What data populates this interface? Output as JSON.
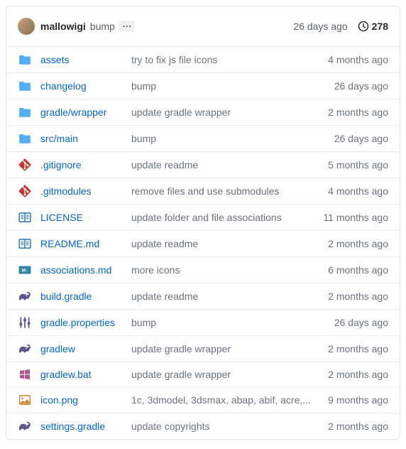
{
  "header": {
    "author": "mallowigi",
    "commit_message": "bump",
    "time": "26 days ago",
    "history_count": "278"
  },
  "files": [
    {
      "icon": "folder",
      "name": "assets",
      "msg": "try to fix js file icons",
      "time": "4 months ago"
    },
    {
      "icon": "folder",
      "name": "changelog",
      "msg": "bump",
      "time": "26 days ago"
    },
    {
      "icon": "folder",
      "name": "gradle/wrapper",
      "msg": "update gradle wrapper",
      "time": "2 months ago"
    },
    {
      "icon": "folder",
      "name": "src/main",
      "msg": "bump",
      "time": "26 days ago"
    },
    {
      "icon": "git",
      "name": ".gitignore",
      "msg": "update readme",
      "time": "5 months ago"
    },
    {
      "icon": "git",
      "name": ".gitmodules",
      "msg": "remove files and use submodules",
      "time": "4 months ago"
    },
    {
      "icon": "license",
      "name": "LICENSE",
      "msg": "update folder and file associations",
      "time": "11 months ago"
    },
    {
      "icon": "readme",
      "name": "README.md",
      "msg": "update readme",
      "time": "2 months ago"
    },
    {
      "icon": "markdown",
      "name": "associations.md",
      "msg": "more icons",
      "time": "6 months ago"
    },
    {
      "icon": "gradle",
      "name": "build.gradle",
      "msg": "update readme",
      "time": "2 months ago"
    },
    {
      "icon": "props",
      "name": "gradle.properties",
      "msg": "bump",
      "time": "26 days ago"
    },
    {
      "icon": "gradle",
      "name": "gradlew",
      "msg": "update gradle wrapper",
      "time": "2 months ago"
    },
    {
      "icon": "windows",
      "name": "gradlew.bat",
      "msg": "update gradle wrapper",
      "time": "2 months ago"
    },
    {
      "icon": "image",
      "name": "icon.png",
      "msg": "1c, 3dmodel, 3dsmax, abap, abif, acre,...",
      "time": "9 months ago"
    },
    {
      "icon": "gradle",
      "name": "settings.gradle",
      "msg": "update copyrights",
      "time": "2 months ago"
    }
  ]
}
